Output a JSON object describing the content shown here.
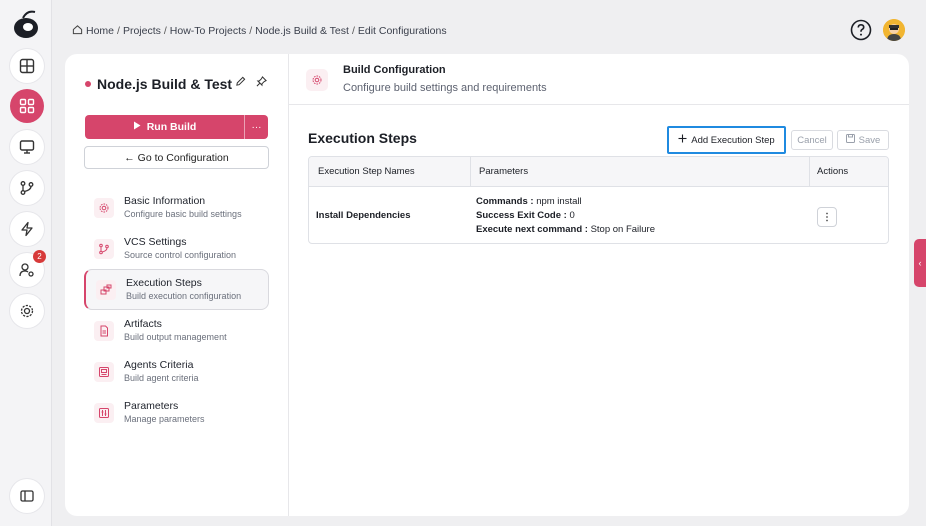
{
  "breadcrumb": {
    "home": "Home",
    "items": [
      "Projects",
      "How-To Projects",
      "Node.js Build & Test",
      "Edit Configurations"
    ]
  },
  "rail": {
    "icons": [
      "logo-icon",
      "dashboard-icon",
      "apps-icon",
      "monitor-icon",
      "vcs-branch-icon",
      "lightning-icon",
      "users-settings-icon",
      "gear-icon",
      "panel-toggle-icon"
    ],
    "users_badge": "2"
  },
  "project": {
    "name": "Node.js Build & Test",
    "run_label": "Run Build",
    "more_label": "···",
    "goto_label": "← Go to Configuration"
  },
  "nav": [
    {
      "title": "Basic Information",
      "subtitle": "Configure basic build settings",
      "icon": "gear-icon"
    },
    {
      "title": "VCS Settings",
      "subtitle": "Source control configuration",
      "icon": "vcs-branch-icon"
    },
    {
      "title": "Execution Steps",
      "subtitle": "Build execution configuration",
      "icon": "steps-icon"
    },
    {
      "title": "Artifacts",
      "subtitle": "Build output management",
      "icon": "file-icon"
    },
    {
      "title": "Agents Criteria",
      "subtitle": "Build agent criteria",
      "icon": "agent-icon"
    },
    {
      "title": "Parameters",
      "subtitle": "Manage parameters",
      "icon": "parameters-icon"
    }
  ],
  "header": {
    "title": "Build Configuration",
    "subtitle": "Configure build settings and requirements"
  },
  "section": {
    "title": "Execution Steps",
    "add_label": "Add Execution Step",
    "cancel_label": "Cancel",
    "save_label": "Save"
  },
  "table": {
    "columns": [
      "Execution Step Names",
      "Parameters",
      "Actions"
    ],
    "rows": [
      {
        "name": "Install Dependencies",
        "commands_label": "Commands :",
        "commands_value": "npm install",
        "exit_label": "Success Exit Code :",
        "exit_value": "0",
        "next_label": "Execute next command :",
        "next_value": "Stop on Failure"
      }
    ]
  },
  "colors": {
    "accent": "#d6456b",
    "focus": "#1f8ae0"
  }
}
